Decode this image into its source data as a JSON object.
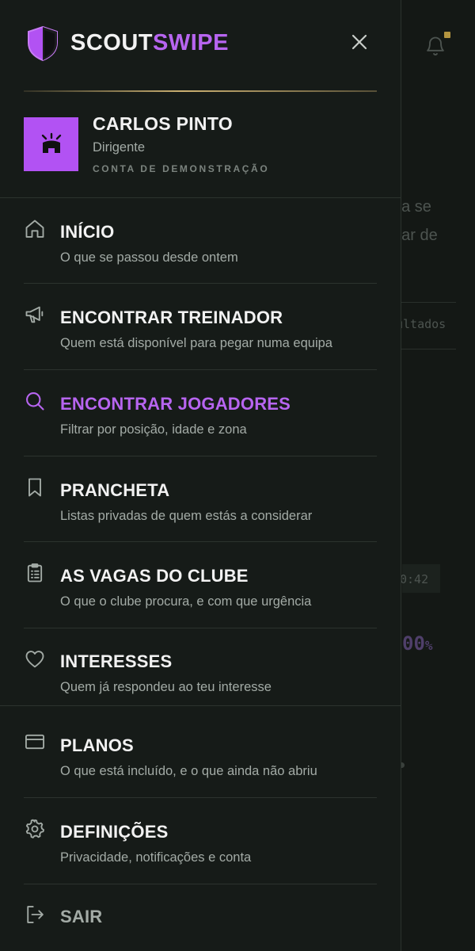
{
  "background": {
    "fragments": [
      "da se",
      "dar de",
      "ultados",
      "0:42",
      "00",
      "%"
    ]
  },
  "brand": {
    "part1": "SCOUT",
    "part2": "SWIPE"
  },
  "user": {
    "name": "CARLOS PINTO",
    "role": "Dirigente",
    "account_tag": "CONTA DE DEMONSTRAÇÃO"
  },
  "nav": [
    {
      "title": "INÍCIO",
      "subtitle": "O que se passou desde ontem",
      "icon": "home-icon"
    },
    {
      "title": "ENCONTRAR TREINADOR",
      "subtitle": "Quem está disponível para pegar numa equipa",
      "icon": "megaphone-icon"
    },
    {
      "title": "ENCONTRAR JOGADORES",
      "subtitle": "Filtrar por posição, idade e zona",
      "icon": "search-icon",
      "active": true
    },
    {
      "title": "PRANCHETA",
      "subtitle": "Listas privadas de quem estás a considerar",
      "icon": "bookmark-icon"
    },
    {
      "title": "AS VAGAS DO CLUBE",
      "subtitle": "O que o clube procura, e com que urgência",
      "icon": "clipboard-icon"
    },
    {
      "title": "INTERESSES",
      "subtitle": "Quem já respondeu ao teu interesse",
      "icon": "heart-icon"
    },
    {
      "title": "PLANOS",
      "subtitle": "O que está incluído, e o que ainda não abriu",
      "icon": "credit-card-icon"
    },
    {
      "title": "DEFINIÇÕES",
      "subtitle": "Privacidade, notificações e conta",
      "icon": "gear-icon"
    }
  ],
  "logout": {
    "label": "SAIR",
    "icon": "logout-icon"
  },
  "colors": {
    "accent": "#b765f0",
    "gold": "#cbb071",
    "background": "#161b18",
    "text": "#f2f2f2",
    "muted_text": "#a3aba6"
  }
}
